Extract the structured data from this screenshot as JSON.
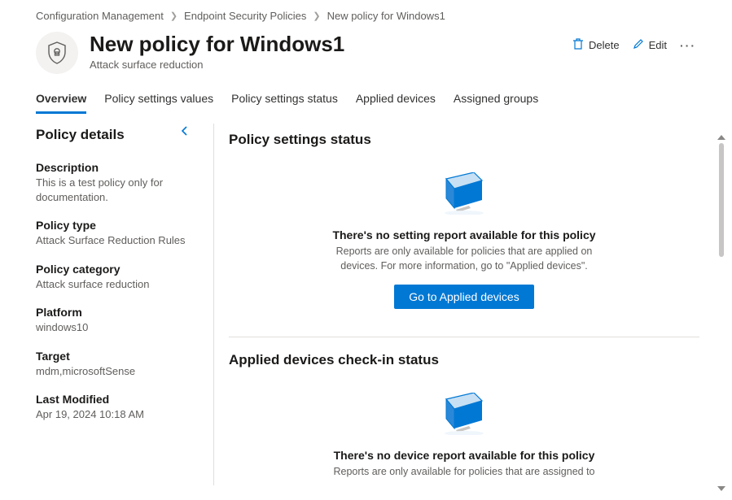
{
  "breadcrumb": {
    "items": [
      "Configuration Management",
      "Endpoint Security Policies",
      "New policy for Windows1"
    ]
  },
  "header": {
    "title": "New policy for Windows1",
    "subtitle": "Attack surface reduction",
    "actions": {
      "delete": "Delete",
      "edit": "Edit"
    }
  },
  "tabs": [
    "Overview",
    "Policy settings values",
    "Policy settings status",
    "Applied devices",
    "Assigned groups"
  ],
  "sidebar": {
    "title": "Policy details",
    "details": [
      {
        "label": "Description",
        "value": "This is a test policy only for documentation."
      },
      {
        "label": "Policy type",
        "value": "Attack Surface Reduction Rules"
      },
      {
        "label": "Policy category",
        "value": "Attack surface reduction"
      },
      {
        "label": "Platform",
        "value": "windows10"
      },
      {
        "label": "Target",
        "value": "mdm,microsoftSense"
      },
      {
        "label": "Last Modified",
        "value": "Apr 19, 2024 10:18 AM"
      }
    ]
  },
  "main": {
    "settingsStatus": {
      "title": "Policy settings status",
      "emptyTitle": "There's no setting report available for this policy",
      "emptyDesc": "Reports are only available for policies that are applied on devices. For more information, go to \"Applied devices\".",
      "button": "Go to Applied devices"
    },
    "devicesCheckin": {
      "title": "Applied devices check-in status",
      "emptyTitle": "There's no device report available for this policy",
      "emptyDesc": "Reports are only available for policies that are assigned to"
    }
  }
}
